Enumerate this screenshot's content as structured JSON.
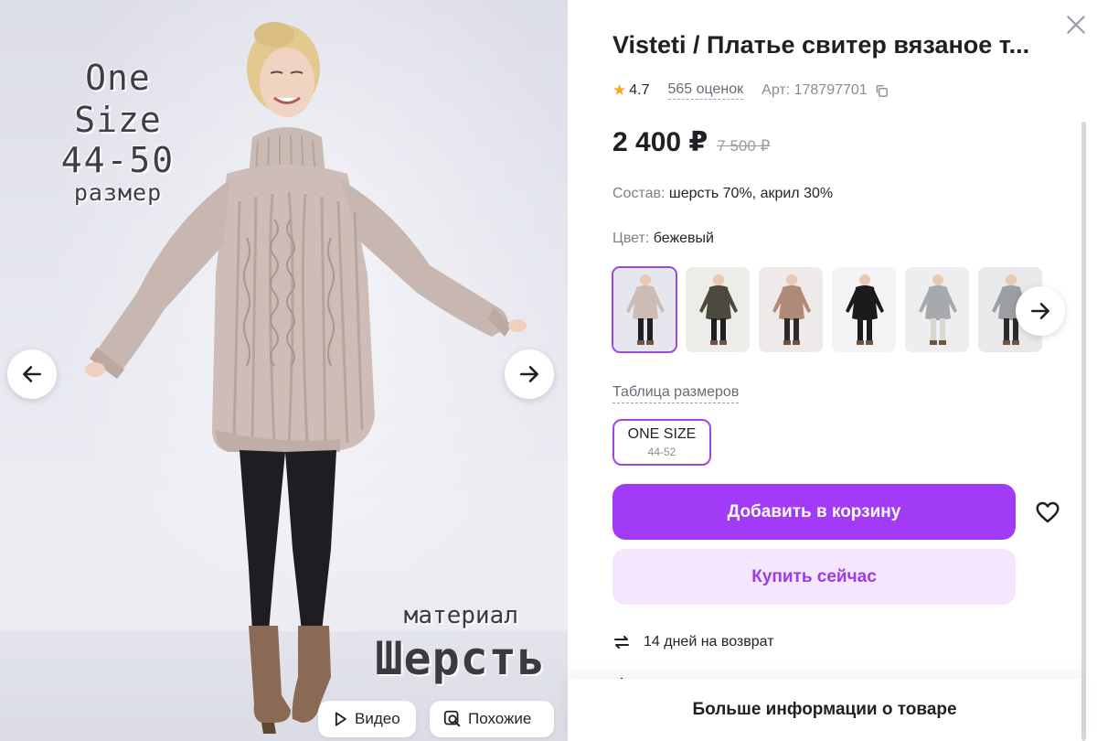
{
  "gallery": {
    "promo_size": {
      "line1": "One Size",
      "line2": "44-50",
      "line3": "размер"
    },
    "promo_material": {
      "line1": "материал",
      "line2": "Шерсть"
    },
    "video_label": "Видео",
    "similar_label": "Похожие"
  },
  "product": {
    "title": "Visteti / Платье свитер вязаное т...",
    "rating": "4.7",
    "reviews": "565 оценок",
    "article": "Арт: 178797701",
    "price": "2 400 ₽",
    "old_price": "7 500 ₽",
    "composition_key": "Состав:",
    "composition_value": "шерсть 70%, акрил 30%",
    "color_key": "Цвет:",
    "color_value": "бежевый"
  },
  "thumbnails": [
    {
      "name": "beige",
      "selected": true,
      "sweater_color": "#cdbcb6",
      "legs": "#1f1f22",
      "bg": "#e6e7ee"
    },
    {
      "name": "olive",
      "selected": false,
      "sweater_color": "#4c4a3e",
      "legs": "#1f1f22",
      "bg": "#ecece8"
    },
    {
      "name": "caramel",
      "selected": false,
      "sweater_color": "#b08a78",
      "legs": "#2b2b2e",
      "bg": "#eeeaea"
    },
    {
      "name": "black",
      "selected": false,
      "sweater_color": "#1b1b1d",
      "legs": "#1b1b1d",
      "bg": "#f4f4f6"
    },
    {
      "name": "grey",
      "selected": false,
      "sweater_color": "#a7aaad",
      "legs": "#dcd6d0",
      "bg": "#eeeef0"
    },
    {
      "name": "grey-2",
      "selected": false,
      "sweater_color": "#9c9fa2",
      "legs": "#2a2a2c",
      "bg": "#e9e9ec"
    }
  ],
  "sizes": {
    "table_label": "Таблица размеров",
    "chip_label": "ONE SIZE",
    "chip_range": "44-52"
  },
  "actions": {
    "add_to_cart": "Добавить в корзину",
    "buy_now": "Купить сейчас"
  },
  "info": {
    "return_policy": "14 дней на возврат",
    "more_info": "Больше информации о товаре"
  },
  "colors": {
    "accent": "#a13bf5",
    "accent_light": "#f3e6fd",
    "rating_star": "#f6a825"
  },
  "icons": [
    "arrow-left-icon",
    "arrow-right-icon",
    "play-icon",
    "search-photo-icon",
    "close-icon",
    "star-icon",
    "copy-icon",
    "heart-icon",
    "return-icon"
  ]
}
